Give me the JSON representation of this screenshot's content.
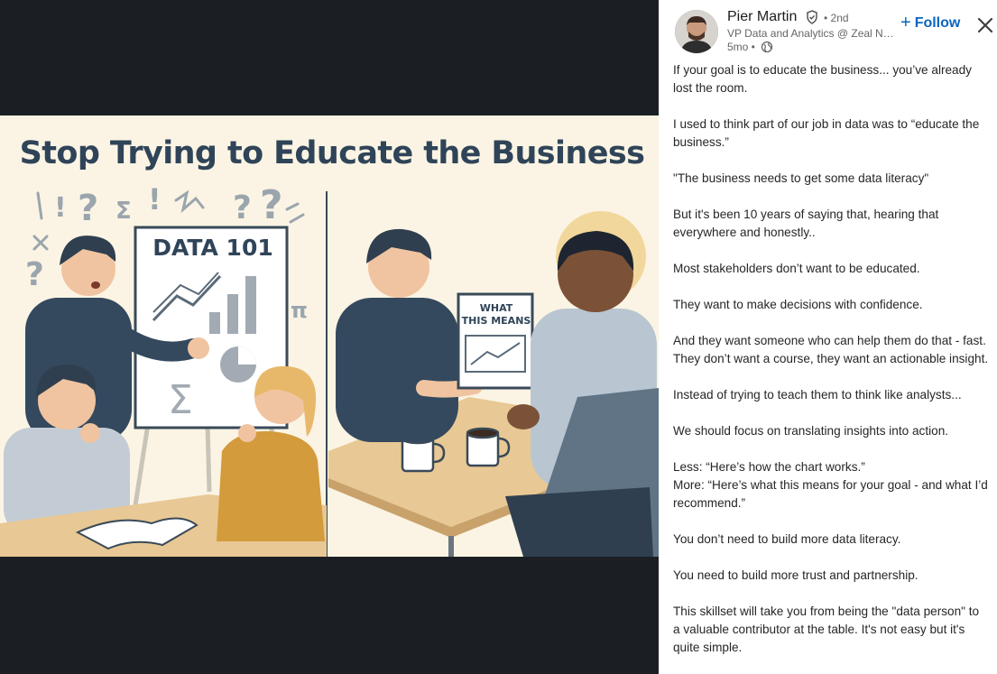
{
  "image": {
    "title": "Stop Trying to Educate the Business",
    "board_text": "DATA 101",
    "card_text_1": "WHAT",
    "card_text_2": "THIS MEANS"
  },
  "author": {
    "name": "Pier Martin",
    "degree": "• 2nd",
    "headline": "VP Data and Analytics @ Zeal Ne...",
    "time": "5mo •"
  },
  "actions": {
    "follow_plus": "+",
    "follow_label": "Follow"
  },
  "post": {
    "paragraphs": [
      "If your goal is to educate the business... you’ve already lost the room.",
      "I used to think part of our job in data was to “educate the business.”",
      "\"The business needs to get some data literacy\"",
      "But it's been 10 years of saying that, hearing that everywhere and honestly..",
      "Most stakeholders don’t want to be educated.",
      "They want to make decisions with confidence.",
      "And they want someone who can help them do that - fast. They don’t want a course, they want an actionable insight.",
      "Instead of trying to teach them to think like analysts...",
      "We should focus on translating insights into action.",
      "Less: “Here’s how the chart works.”",
      "More: “Here’s what this means for your goal - and what I’d recommend.”",
      "You don’t need to build more data literacy.",
      "You need to build more trust and partnership.",
      "This skillset will take you from being the \"data person\" to a valuable contributor at the table. It's not easy but it's quite simple."
    ]
  },
  "colors": {
    "follow": "#0a66c2",
    "viewer_bg": "#1b1f23",
    "image_bg": "#fbf4e4",
    "title_color": "#2f4458"
  },
  "icons": [
    "verified-icon",
    "globe-icon",
    "close-icon",
    "plus-icon"
  ]
}
